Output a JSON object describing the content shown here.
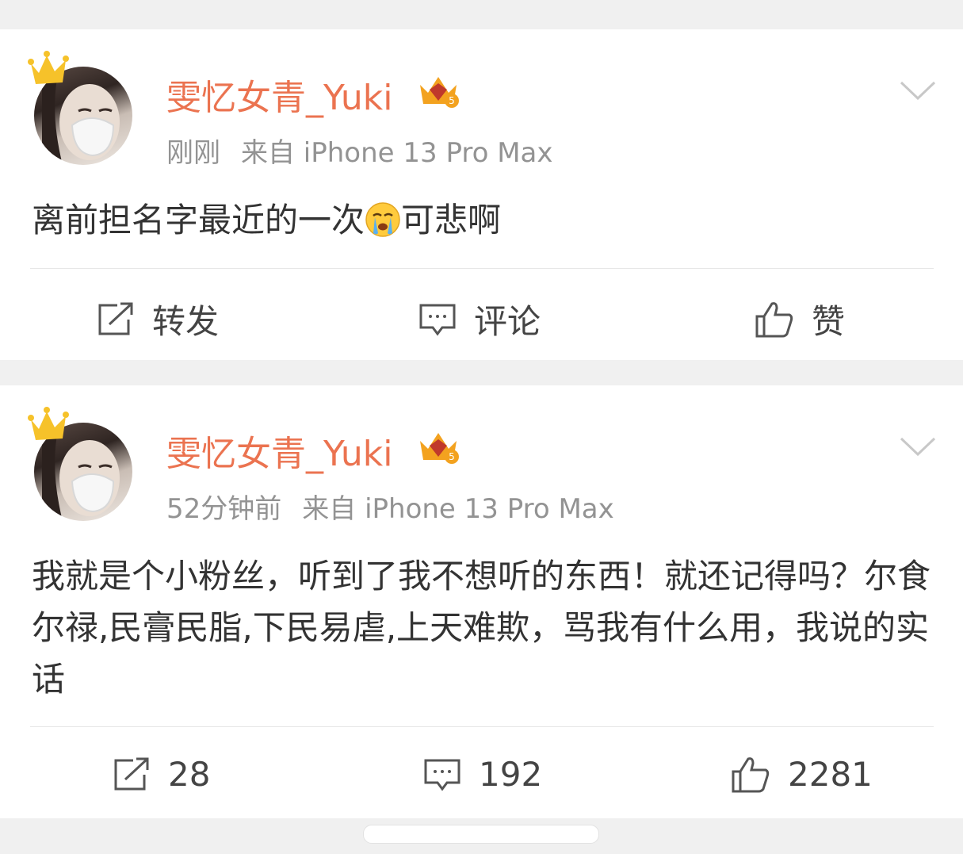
{
  "posts": [
    {
      "username": "雯忆女青_Yuki",
      "time": "刚刚",
      "source": "来自 iPhone 13 Pro Max",
      "text_before_emoji": "离前担名字最近的一次",
      "emoji": "crying-face-emoji",
      "text_after_emoji": "可悲啊",
      "actions": {
        "repost": "转发",
        "comment": "评论",
        "like": "赞"
      }
    },
    {
      "username": "雯忆女青_Yuki",
      "time": "52分钟前",
      "source": "来自 iPhone 13 Pro Max",
      "text": "我就是个小粉丝，听到了我不想听的东西！就还记得吗？尔食尔禄,民膏民脂,下民易虐,上天难欺，骂我有什么用，我说的实话",
      "actions": {
        "repost": "28",
        "comment": "192",
        "like": "2281"
      }
    }
  ],
  "colors": {
    "username": "#eb7350",
    "meta": "#939393",
    "text": "#333333",
    "background": "#f0f0f0"
  },
  "icons": [
    "crown-icon",
    "vip-badge-icon",
    "chevron-down-icon",
    "repost-icon",
    "comment-icon",
    "like-icon"
  ]
}
